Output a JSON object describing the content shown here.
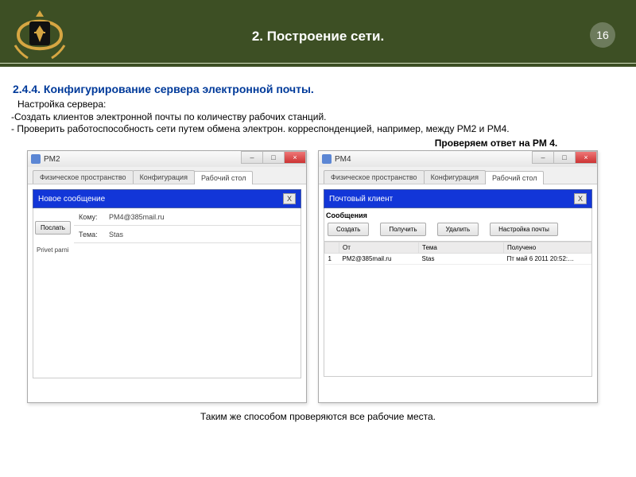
{
  "header": {
    "title": "2.  Построение сети.",
    "page": "16"
  },
  "section": {
    "num_title": "2.4.4. Конфигурирование сервера электронной почты.",
    "sub": "Настройка  сервера:",
    "bullet1": "-Создать клиентов электронной почты по количеству рабочих станций.",
    "bullet2": "- Проверить работоспособность сети путем обмена электрон. корреспонденцией, например, между РМ2 и РМ4.",
    "check_label": "Проверяем ответ на PM 4."
  },
  "left_win": {
    "title": "PM2",
    "tabs": {
      "t1": "Физическое пространство",
      "t2": "Конфигурация",
      "t3": "Рабочий стол"
    },
    "panel_title": "Новое сообщение",
    "send": "Послать",
    "to_lbl": "Кому:",
    "to_val": "PM4@385mail.ru",
    "subj_lbl": "Тема:",
    "subj_val": "Stas",
    "body": "Privet parni"
  },
  "right_win": {
    "title": "PM4",
    "tabs": {
      "t1": "Физическое пространство",
      "t2": "Конфигурация",
      "t3": "Рабочий стол"
    },
    "panel_title": "Почтовый клиент",
    "section_label": "Сообщения",
    "btns": {
      "create": "Создать",
      "receive": "Получить",
      "delete": "Удалить",
      "settings": "Настройка почты"
    },
    "cols": {
      "idx": "",
      "from": "От",
      "subj": "Тема",
      "recv": "Получено"
    },
    "row": {
      "idx": "1",
      "from": "PM2@385mail.ru",
      "subj": "Stas",
      "recv": "Пт май 6 2011 20:52:…"
    }
  },
  "footer": "Таким же способом проверяются все рабочие места."
}
